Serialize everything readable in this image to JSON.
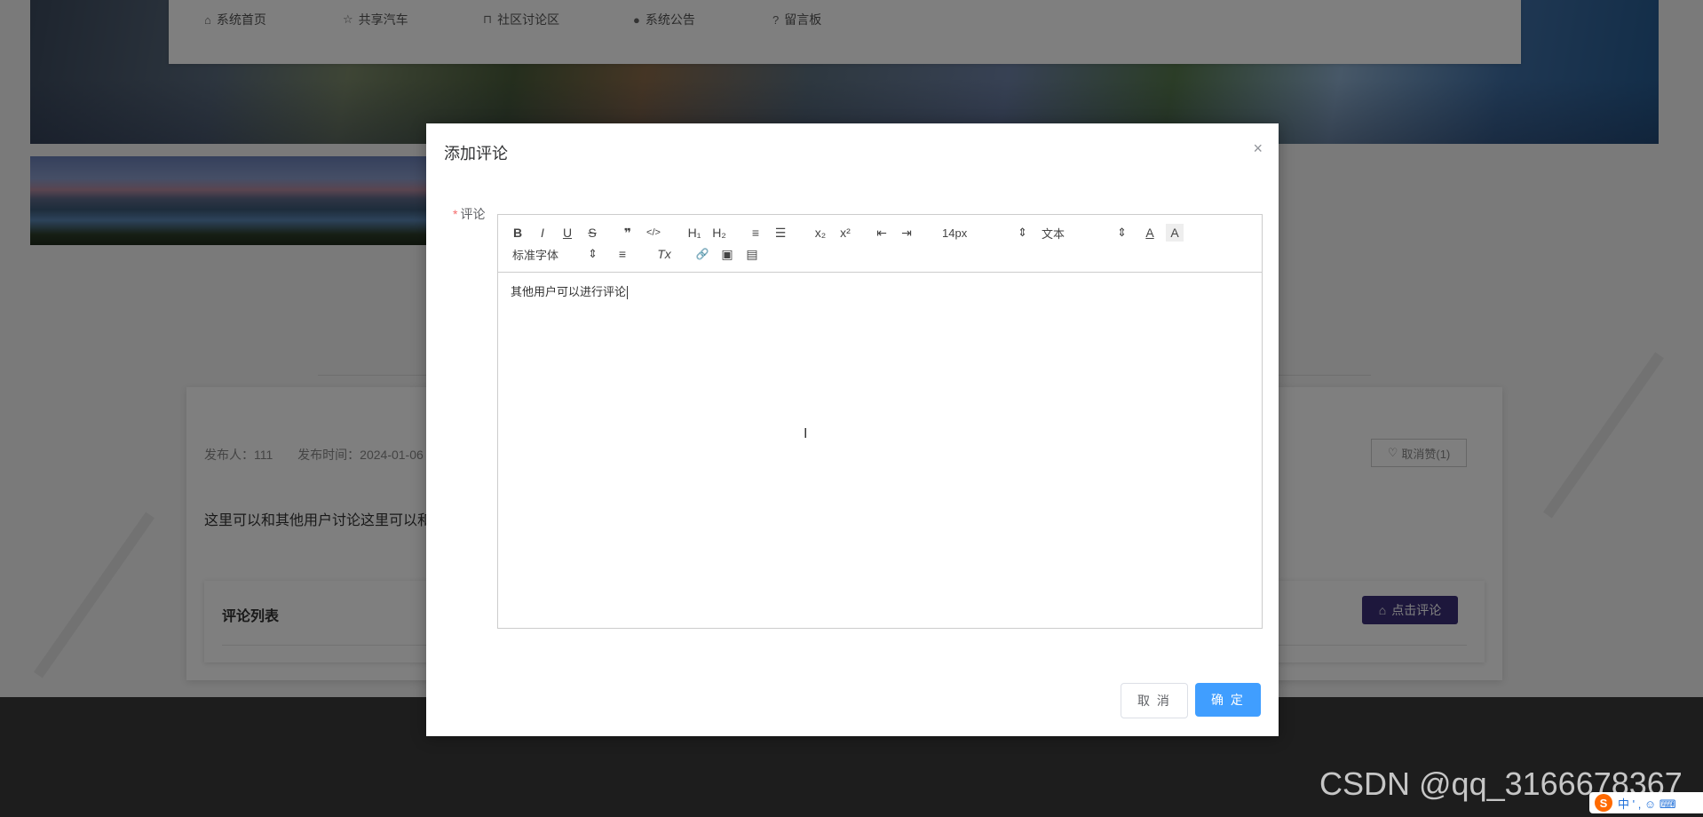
{
  "nav": {
    "items": [
      {
        "icon": "home-icon",
        "glyph": "⌂",
        "label": "系统首页"
      },
      {
        "icon": "star-icon",
        "glyph": "☆",
        "label": "共享汽车"
      },
      {
        "icon": "bag-icon",
        "glyph": "⊓",
        "label": "社区讨论区"
      },
      {
        "icon": "info-icon",
        "glyph": "●",
        "label": "系统公告"
      },
      {
        "icon": "question-icon",
        "glyph": "?",
        "label": "留言板"
      }
    ]
  },
  "post": {
    "publisher": "发布人：111",
    "publish_time": "发布时间：2024-01-06",
    "like_button": "取消赞(1)",
    "body": "这里可以和其他用户讨论这里可以和",
    "comments_title": "评论列表",
    "comment_button": "点击评论"
  },
  "modal": {
    "title": "添加评论",
    "close_glyph": "×",
    "field_label": "评论",
    "required_mark": "*",
    "font_size": "14px",
    "heading_select": "文本",
    "font_family": "标准字体",
    "content": "其他用户可以进行评论",
    "cancel": "取 消",
    "confirm": "确 定"
  },
  "toolbar": {
    "bold": "B",
    "italic": "I",
    "underline": "U",
    "strike": "S",
    "quote": "❞",
    "code": "</>",
    "h1": "H₁",
    "h2": "H₂",
    "ordered_list": "≡",
    "bullet_list": "☰",
    "sub": "x₂",
    "sup": "x²",
    "outdent": "⇤",
    "indent": "⇥",
    "color": "A",
    "background": "A",
    "align": "≡",
    "clean": "Tx",
    "link": "🔗",
    "image": "▣",
    "save": "▤",
    "select_arrow": "⇕"
  },
  "watermark": "CSDN @qq_3166678367",
  "ime": {
    "logo": "S",
    "label": "中 ' , ☺ ⌨"
  },
  "colors": {
    "accent": "#409eff",
    "comment_btn": "#3b2f78",
    "required": "#f56c6c"
  }
}
